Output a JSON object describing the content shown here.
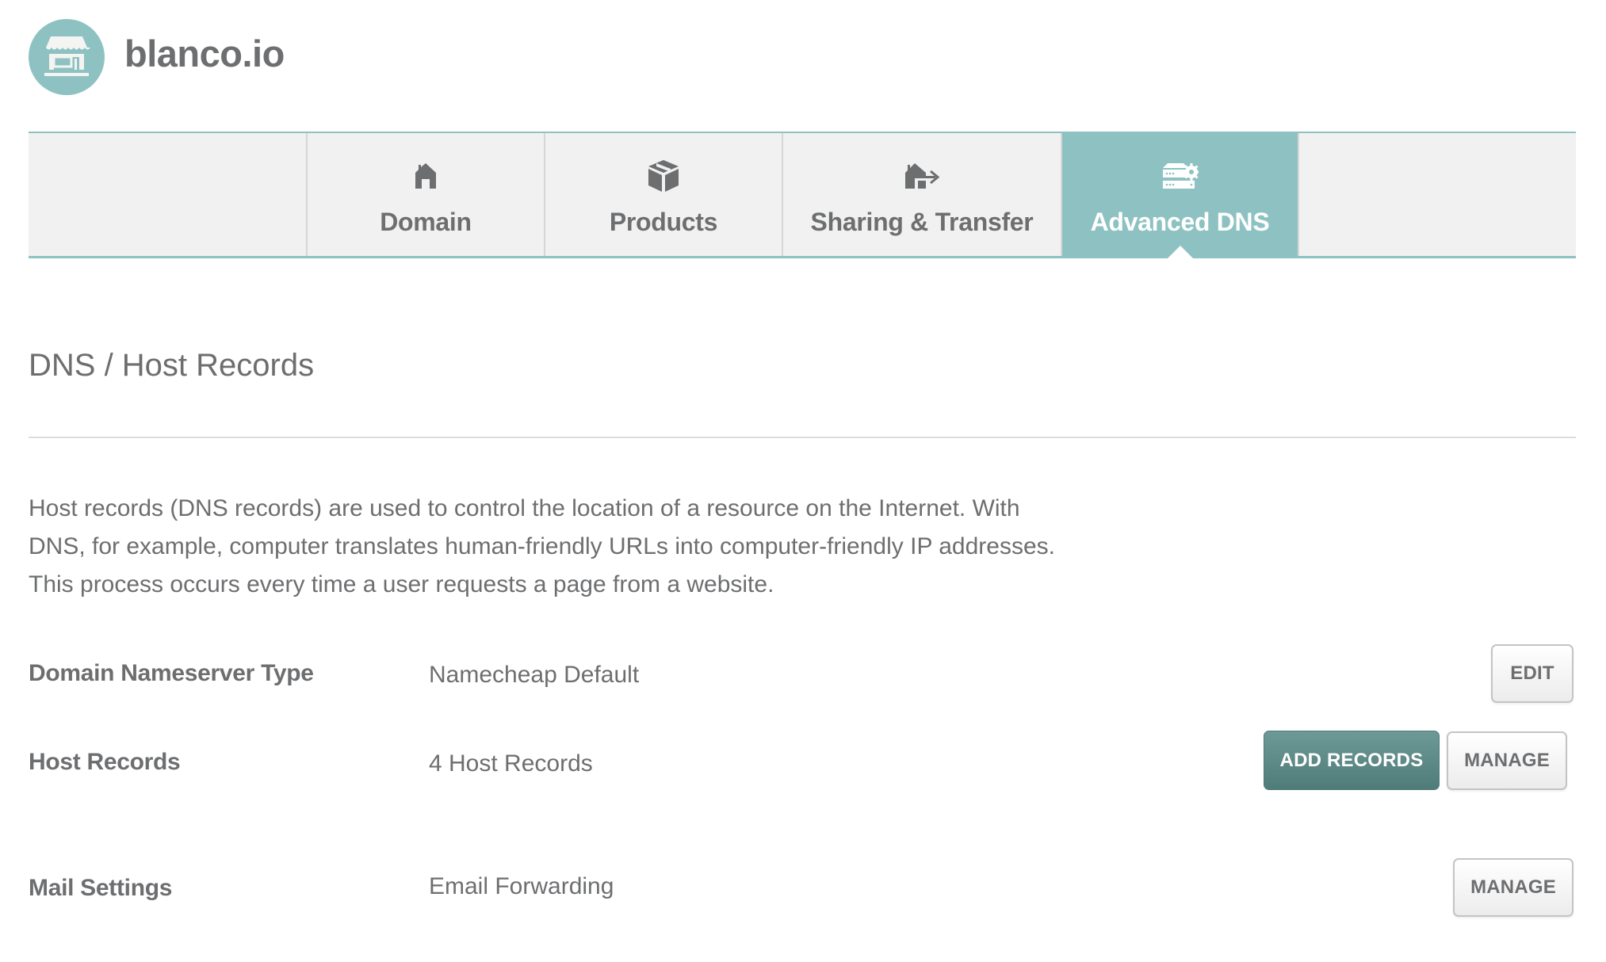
{
  "header": {
    "brand": "blanco.io",
    "logo_icon": "storefront-icon"
  },
  "tabs": [
    {
      "label": "Domain",
      "icon": "house-icon",
      "active": false
    },
    {
      "label": "Products",
      "icon": "box-icon",
      "active": false
    },
    {
      "label": "Sharing & Transfer",
      "icon": "house-transfer-icon",
      "active": false
    },
    {
      "label": "Advanced DNS",
      "icon": "server-gear-icon",
      "active": true
    }
  ],
  "section": {
    "title": "DNS / Host Records",
    "description_lines": [
      "Host records (DNS records) are used to control the location of a resource on the Internet. With",
      "DNS, for example, computer translates human-friendly URLs into computer-friendly IP addresses.",
      "This process occurs every time a user requests a page from a website."
    ]
  },
  "rows": [
    {
      "label": "Domain Nameserver Type",
      "value": "Namecheap Default",
      "buttons": [
        "EDIT"
      ]
    },
    {
      "label": "Host Records",
      "value": "4 Host Records",
      "buttons": [
        "ADD RECORDS",
        "MANAGE"
      ]
    },
    {
      "label": "Mail Settings",
      "value": "Email Forwarding",
      "buttons": [
        "MANAGE"
      ]
    }
  ],
  "colors": {
    "accent": "#8ec2c2",
    "primary_button": "#5f8b88",
    "text": "#6d6e70",
    "tab_background": "#f1f1f1"
  }
}
